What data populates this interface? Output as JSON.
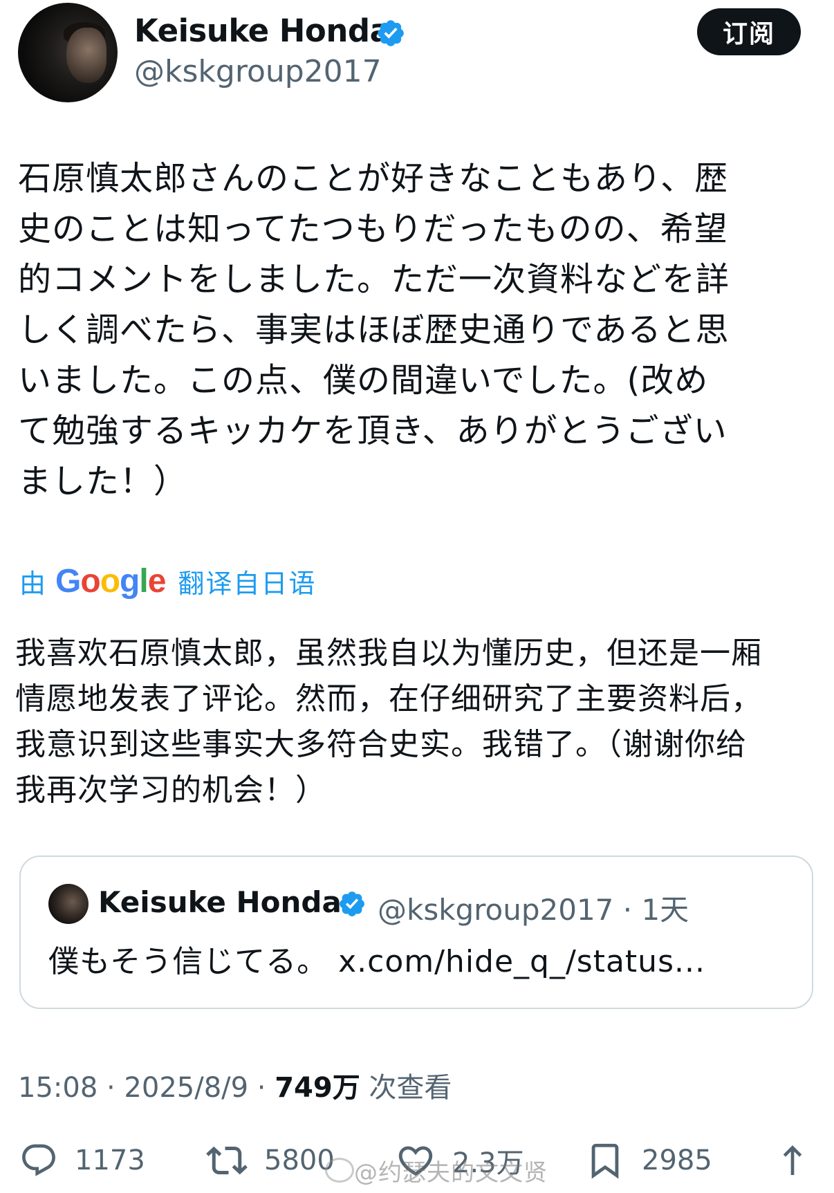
{
  "author": {
    "display_name": "Keisuke Honda",
    "handle": "@kskgroup2017",
    "verified": true
  },
  "subscribe_label": "订阅",
  "tweet": {
    "text": "石原慎太郎さんのことが好きなこともあり、歴\n史のことは知ってたつもりだったものの、希望\n的コメントをしました。ただ一次資料などを詳\nしく調べたら、事実はほぼ歴史通りであると思\nいました。この点、僕の間違いでした。(改め\nて勉強するキッカケを頂き、ありがとうござい\nました！）"
  },
  "translation": {
    "by_label": "由",
    "provider": "Google",
    "from_label": "翻译自日语",
    "text": "我喜欢石原慎太郎，虽然我自以为懂历史，但还是一厢\n情愿地发表了评论。然而，在仔细研究了主要资料后，\n我意识到这些事实大多符合史实。我错了。（谢谢你给\n我再次学习的机会！）"
  },
  "quote": {
    "display_name": "Keisuke Honda",
    "handle_time": "@kskgroup2017 · 1天",
    "text": "僕もそう信じてる。 x.com/hide_q_/status..."
  },
  "meta": {
    "time": "15:08 · 2025/8/9 · ",
    "views": "749万",
    "views_label": " 次查看"
  },
  "actions": {
    "replies": "1173",
    "retweets": "5800",
    "likes": "2.3万",
    "bookmarks": "2985"
  },
  "watermark": "@约瑟夫的文文贤",
  "colors": {
    "accent": "#1d9bf0",
    "text": "#0f1419",
    "secondary": "#536471",
    "border": "#cfd9de"
  },
  "icons": {
    "verified": "verified-badge-icon",
    "reply": "reply-icon",
    "retweet": "retweet-icon",
    "like": "heart-icon",
    "bookmark": "bookmark-icon",
    "share": "share-icon"
  }
}
